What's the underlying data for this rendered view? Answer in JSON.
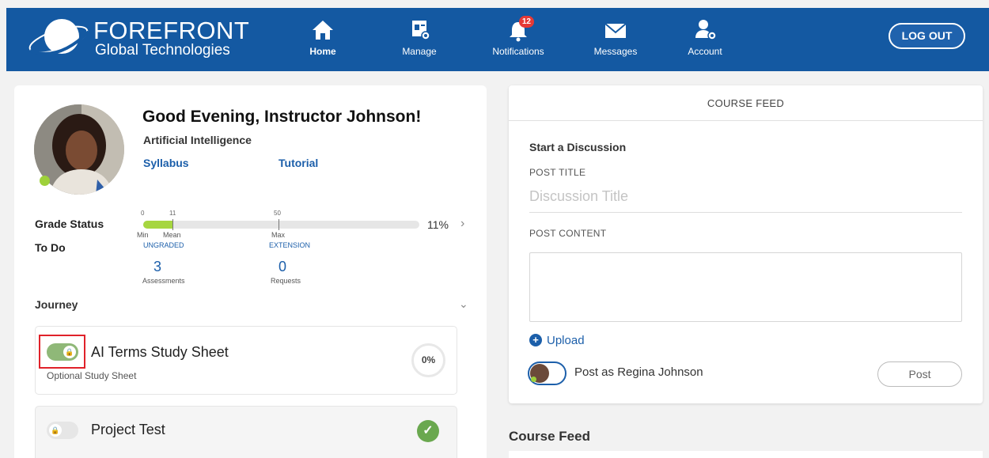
{
  "header": {
    "logo_title": "FOREFRONT",
    "logo_subtitle": "Global Technologies",
    "nav": [
      {
        "label": "Home",
        "icon": "home-icon",
        "active": true
      },
      {
        "label": "Manage",
        "icon": "manage-icon"
      },
      {
        "label": "Notifications",
        "icon": "bell-icon",
        "badge": "12"
      },
      {
        "label": "Messages",
        "icon": "envelope-icon"
      },
      {
        "label": "Account",
        "icon": "account-gear-icon"
      }
    ],
    "logout_label": "LOG OUT"
  },
  "profile": {
    "greeting": "Good Evening, Instructor Johnson!",
    "course": "Artificial Intelligence",
    "syllabus_link": "Syllabus",
    "tutorial_link": "Tutorial"
  },
  "grade_status": {
    "label": "Grade Status",
    "tick_min": "0",
    "tick_mean": "11",
    "tick_max": "50",
    "min_label": "Min",
    "mean_label": "Mean",
    "max_label": "Max",
    "fill_fraction": 0.11,
    "percent": "11%"
  },
  "todo": {
    "label": "To Do",
    "ungraded_label": "UNGRADED",
    "ungraded_count": "3",
    "ungraded_sub": "Assessments",
    "extension_label": "EXTENSION",
    "extension_count": "0",
    "extension_sub": "Requests"
  },
  "journey": {
    "label": "Journey",
    "items": [
      {
        "title": "AI Terms Study Sheet",
        "subtitle": "Optional Study Sheet",
        "progress": "0%",
        "toggle_on": true
      },
      {
        "title": "Project Test",
        "completed": true,
        "toggle_on": false
      }
    ]
  },
  "course_feed": {
    "header": "COURSE FEED",
    "start_discussion": "Start a Discussion",
    "post_title_label": "POST TITLE",
    "post_title_placeholder": "Discussion Title",
    "post_content_label": "POST CONTENT",
    "upload_label": "Upload",
    "post_as_label": "Post as Regina Johnson",
    "post_button": "Post",
    "section_title": "Course Feed"
  },
  "colors": {
    "header_bg": "#1459a2",
    "link": "#1c5faa",
    "grade_fill": "#a6d640",
    "toggle_on": "#8fb878",
    "highlight": "#e0222a",
    "complete_check": "#6aa84f"
  }
}
